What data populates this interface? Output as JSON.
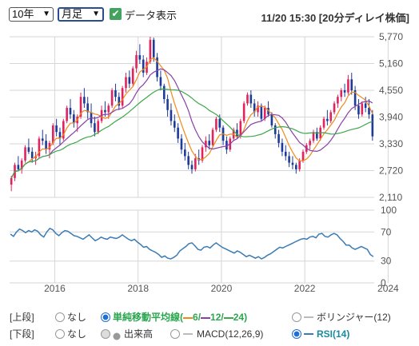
{
  "toolbar": {
    "period_value": "10年",
    "interval_value": "月足",
    "data_display_label": "データ表示",
    "timestamp": "11/20 15:30 [20分ディレイ株価]"
  },
  "colors": {
    "up": "#e0245e",
    "down": "#1f3b9a",
    "ma6": "#f08a1c",
    "ma12": "#8a3fa8",
    "ma24": "#3da84a",
    "rsi": "#3a7bb5",
    "grid": "#d6d6d6"
  },
  "controls": {
    "upper_label": "[上段]",
    "lower_label": "[下段]",
    "none_label": "なし",
    "ma_label": "単純移動平均線",
    "ma_6": "6/",
    "ma_12": "12/",
    "ma_24": "24)",
    "ma_open": "(",
    "bollinger_label": "ボリンジャー(12)",
    "volume_label": "出来高",
    "macd_label": "MACD(12,26,9)",
    "rsi_label": "RSI(14)"
  },
  "chart_data": [
    {
      "type": "candlestick",
      "interval": "monthly",
      "y_ticks": [
        "5,770",
        "5,160",
        "4,550",
        "3,940",
        "3,330",
        "2,720",
        "2,110"
      ],
      "ylim": [
        2110,
        5770
      ],
      "x_ticks": [
        "2016",
        "2018",
        "2020",
        "2022",
        "2024"
      ],
      "x_start": "2014-12",
      "overlays": [
        "MA(6)",
        "MA(12)",
        "MA(24)"
      ],
      "ohlc": [
        [
          2400,
          2600,
          2250,
          2550
        ],
        [
          2550,
          2900,
          2480,
          2850
        ],
        [
          2850,
          3050,
          2700,
          2750
        ],
        [
          2750,
          3000,
          2650,
          2950
        ],
        [
          2950,
          3300,
          2900,
          3250
        ],
        [
          3250,
          3450,
          3100,
          3150
        ],
        [
          3150,
          3250,
          2900,
          3000
        ],
        [
          3000,
          3150,
          2850,
          3050
        ],
        [
          3050,
          3500,
          3000,
          3450
        ],
        [
          3450,
          3650,
          3300,
          3400
        ],
        [
          3400,
          3550,
          3100,
          3200
        ],
        [
          3200,
          3400,
          3000,
          3350
        ],
        [
          3350,
          3800,
          3300,
          3750
        ],
        [
          3750,
          3900,
          3500,
          3600
        ],
        [
          3600,
          3700,
          3300,
          3450
        ],
        [
          3450,
          3900,
          3400,
          3850
        ],
        [
          3850,
          4200,
          3800,
          4150
        ],
        [
          4150,
          4350,
          3900,
          4000
        ],
        [
          4000,
          4100,
          3700,
          3800
        ],
        [
          3800,
          4000,
          3600,
          3950
        ],
        [
          3950,
          4500,
          3900,
          4400
        ],
        [
          4400,
          4600,
          4150,
          4250
        ],
        [
          4250,
          4400,
          3900,
          4050
        ],
        [
          4050,
          4250,
          3700,
          3800
        ],
        [
          3800,
          3950,
          3500,
          3600
        ],
        [
          3600,
          3900,
          3550,
          3850
        ],
        [
          3850,
          4200,
          3800,
          4100
        ],
        [
          4100,
          4300,
          3950,
          4050
        ],
        [
          4050,
          4250,
          3900,
          4200
        ],
        [
          4200,
          4600,
          4150,
          4550
        ],
        [
          4550,
          4700,
          4300,
          4400
        ],
        [
          4400,
          4500,
          4100,
          4200
        ],
        [
          4200,
          4650,
          4150,
          4600
        ],
        [
          4600,
          4950,
          4500,
          4850
        ],
        [
          4850,
          5000,
          4600,
          4700
        ],
        [
          4700,
          5100,
          4650,
          5050
        ],
        [
          5050,
          5450,
          4950,
          5350
        ],
        [
          5350,
          5600,
          5150,
          5250
        ],
        [
          5250,
          5350,
          4850,
          4950
        ],
        [
          4950,
          5300,
          4900,
          5200
        ],
        [
          5200,
          5770,
          5150,
          5700
        ],
        [
          5700,
          5750,
          5200,
          5300
        ],
        [
          5300,
          5400,
          4750,
          4850
        ],
        [
          4850,
          5000,
          4550,
          4650
        ],
        [
          4650,
          4700,
          4250,
          4350
        ],
        [
          4350,
          4450,
          3950,
          4100
        ],
        [
          4100,
          4250,
          3750,
          3850
        ],
        [
          3850,
          4000,
          3600,
          3700
        ],
        [
          3700,
          3800,
          3350,
          3450
        ],
        [
          3450,
          3550,
          3100,
          3200
        ],
        [
          3200,
          3350,
          2950,
          3050
        ],
        [
          3050,
          3150,
          2750,
          2850
        ],
        [
          2850,
          2950,
          2650,
          2750
        ],
        [
          2750,
          3100,
          2700,
          3000
        ],
        [
          3000,
          3200,
          2850,
          2950
        ],
        [
          2950,
          3300,
          2900,
          3250
        ],
        [
          3250,
          3500,
          3150,
          3400
        ],
        [
          3400,
          3550,
          3200,
          3300
        ],
        [
          3300,
          3700,
          3250,
          3650
        ],
        [
          3650,
          3950,
          3600,
          3900
        ],
        [
          3900,
          4000,
          3600,
          3700
        ],
        [
          3700,
          3750,
          3300,
          3400
        ],
        [
          3400,
          3500,
          3100,
          3200
        ],
        [
          3200,
          3500,
          3150,
          3450
        ],
        [
          3450,
          3700,
          3400,
          3650
        ],
        [
          3650,
          3800,
          3450,
          3500
        ],
        [
          3500,
          3900,
          3450,
          3850
        ],
        [
          3850,
          4300,
          3800,
          4250
        ],
        [
          4250,
          4500,
          4200,
          4450
        ],
        [
          4450,
          4550,
          4150,
          4250
        ],
        [
          4250,
          4350,
          3950,
          4050
        ],
        [
          4050,
          4300,
          3950,
          4200
        ],
        [
          4200,
          4250,
          3850,
          3900
        ],
        [
          3900,
          4200,
          3850,
          4150
        ],
        [
          4150,
          4300,
          3950,
          4000
        ],
        [
          4000,
          4050,
          3700,
          3750
        ],
        [
          3750,
          3800,
          3450,
          3550
        ],
        [
          3550,
          3650,
          3250,
          3350
        ],
        [
          3350,
          3450,
          3050,
          3150
        ],
        [
          3150,
          3300,
          2950,
          3050
        ],
        [
          3050,
          3150,
          2800,
          2900
        ],
        [
          2900,
          3050,
          2750,
          2850
        ],
        [
          2850,
          2900,
          2650,
          2750
        ],
        [
          2750,
          3000,
          2700,
          2950
        ],
        [
          2950,
          3200,
          2900,
          3150
        ],
        [
          3150,
          3350,
          3100,
          3300
        ],
        [
          3300,
          3450,
          3200,
          3400
        ],
        [
          3400,
          3650,
          3350,
          3600
        ],
        [
          3600,
          3700,
          3400,
          3450
        ],
        [
          3450,
          3750,
          3400,
          3700
        ],
        [
          3700,
          3950,
          3650,
          3900
        ],
        [
          3900,
          4100,
          3750,
          3850
        ],
        [
          3850,
          4100,
          3800,
          4050
        ],
        [
          4050,
          4300,
          4000,
          4250
        ],
        [
          4250,
          4450,
          4150,
          4400
        ],
        [
          4400,
          4600,
          4300,
          4550
        ],
        [
          4550,
          4700,
          4400,
          4500
        ],
        [
          4500,
          4900,
          4450,
          4800
        ],
        [
          4800,
          4950,
          4450,
          4550
        ],
        [
          4550,
          4650,
          4100,
          4200
        ],
        [
          4200,
          4350,
          3900,
          4000
        ],
        [
          4000,
          4300,
          3950,
          4250
        ],
        [
          4250,
          4400,
          4050,
          4150
        ],
        [
          4150,
          4350,
          3900,
          4000
        ],
        [
          4000,
          4100,
          3400,
          3500
        ]
      ]
    },
    {
      "type": "line",
      "name": "RSI(14)",
      "y_ticks": [
        "100",
        "70",
        "30",
        "0"
      ],
      "ylim": [
        0,
        100
      ],
      "values": [
        67,
        64,
        70,
        74,
        72,
        69,
        72,
        70,
        73,
        71,
        66,
        63,
        70,
        75,
        73,
        68,
        65,
        69,
        72,
        71,
        68,
        65,
        64,
        62,
        60,
        63,
        66,
        62,
        58,
        60,
        63,
        61,
        60,
        63,
        62,
        61,
        63,
        66,
        63,
        60,
        58,
        60,
        56,
        53,
        49,
        50,
        46,
        44,
        42,
        39,
        35,
        37,
        34,
        33,
        35,
        38,
        44,
        47,
        50,
        54,
        55,
        51,
        46,
        45,
        49,
        50,
        48,
        52,
        55,
        52,
        49,
        47,
        45,
        43,
        41,
        44,
        42,
        39,
        36,
        38,
        36,
        34,
        36,
        33,
        35,
        38,
        40,
        43,
        46,
        49,
        48,
        50,
        52,
        54,
        56,
        58,
        60,
        61,
        60,
        63,
        64,
        62,
        67,
        68,
        64,
        63,
        66,
        68,
        66,
        61,
        57,
        52,
        52,
        48,
        46,
        48,
        50,
        48,
        46,
        39,
        36
      ]
    }
  ]
}
